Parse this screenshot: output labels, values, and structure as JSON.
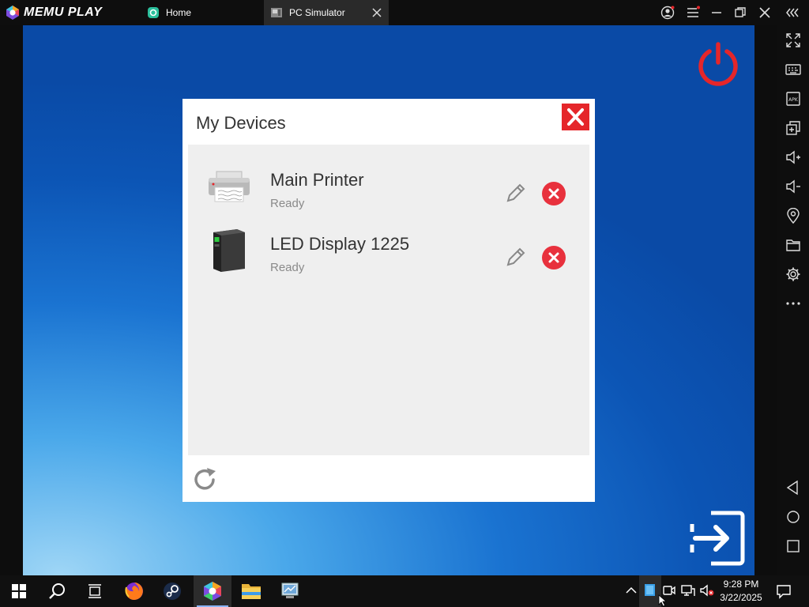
{
  "app": {
    "brand": "MEMU PLAY",
    "tabs": [
      {
        "label": "Home",
        "active": false,
        "icon": "memu-home-icon"
      },
      {
        "label": "PC Simulator",
        "active": true,
        "icon": "pc-simulator-icon"
      }
    ]
  },
  "colors": {
    "close_red": "#e5262a",
    "power_red": "#e5262a",
    "dialog_bg": "#ffffff",
    "list_bg": "#efefef"
  },
  "dialog": {
    "title": "My Devices",
    "devices": [
      {
        "name": "Main Printer",
        "status": "Ready",
        "icon": "printer-icon"
      },
      {
        "name": "LED Display 1225",
        "status": "Ready",
        "icon": "pc-tower-icon"
      }
    ]
  },
  "taskbar": {
    "apps": [
      "windows-start-icon",
      "search-icon",
      "task-view-icon",
      "firefox-icon",
      "steam-icon",
      "pc-simulator-app-icon",
      "file-explorer-icon",
      "control-panel-icon"
    ],
    "time": "9:28 PM",
    "date": "3/22/2025"
  }
}
